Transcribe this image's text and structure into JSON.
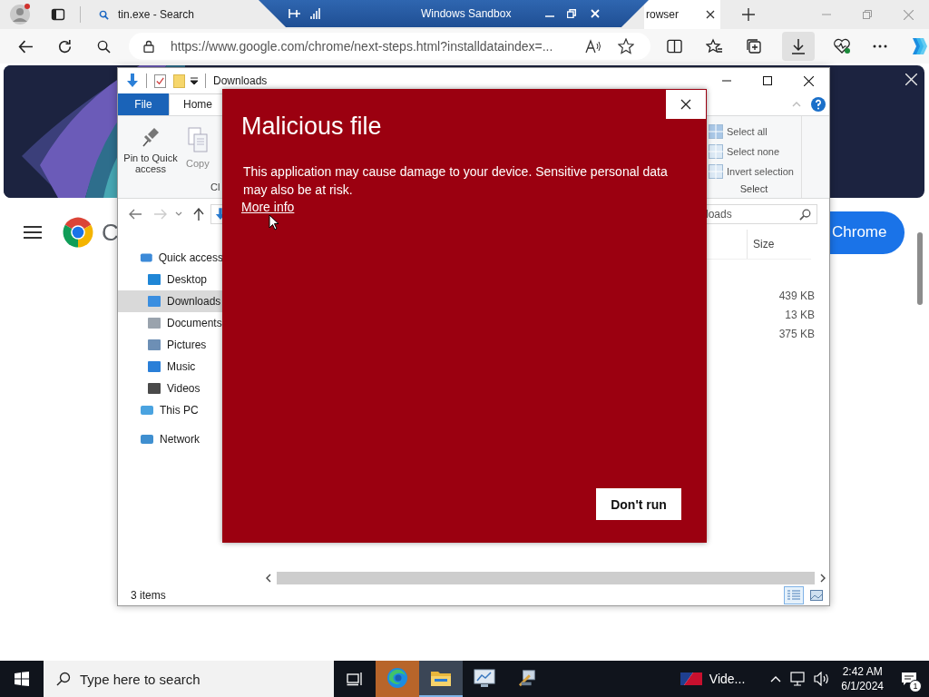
{
  "browser": {
    "tabs": [
      {
        "label": "tin.exe - Search",
        "selected": false
      },
      {
        "label": "rowser",
        "selected": true
      }
    ],
    "address": "https://www.google.com/chrome/next-steps.html?installdataindex=...",
    "page": {
      "brand_letter": "C",
      "button": "Chrome"
    }
  },
  "sandbox_bar": {
    "title": "Windows Sandbox"
  },
  "explorer": {
    "title": "Downloads",
    "ribbon_tabs": [
      {
        "label": "File",
        "kind": "file",
        "selected": false
      },
      {
        "label": "Home",
        "kind": "tab",
        "selected": true
      }
    ],
    "clipboard": {
      "buttons": [
        "Pin to Quick access",
        "Copy"
      ],
      "group_label": "Cl"
    },
    "select": {
      "commands": [
        "Select all",
        "Select none",
        "Invert selection"
      ],
      "group_label": "Select"
    },
    "search": {
      "value": "loads"
    },
    "column": "Size",
    "nav": [
      {
        "label": "Quick access",
        "selected": false,
        "children": [
          {
            "label": "Desktop",
            "selected": false
          },
          {
            "label": "Downloads",
            "selected": true
          },
          {
            "label": "Documents",
            "selected": false
          },
          {
            "label": "Pictures",
            "selected": false
          },
          {
            "label": "Music",
            "selected": false
          },
          {
            "label": "Videos",
            "selected": false
          }
        ]
      },
      {
        "label": "This PC",
        "selected": false
      },
      {
        "label": "Network",
        "selected": false
      }
    ],
    "files": [
      {
        "size": "439 KB"
      },
      {
        "size": "13 KB"
      },
      {
        "size": "375 KB"
      }
    ],
    "status": "3 items"
  },
  "dialog": {
    "title": "Malicious file",
    "message": "This application may cause damage to your device. Sensitive personal data may also be at risk.",
    "link": "More info",
    "button": "Don't run"
  },
  "taskbar": {
    "search_placeholder": "Type here to search",
    "apps": [
      {
        "flashing": true,
        "selected": false
      },
      {
        "flashing": false,
        "selected": true
      },
      {
        "flashing": false,
        "selected": false
      },
      {
        "flashing": false,
        "selected": false
      }
    ],
    "widget": "Vide...",
    "time": "2:42 AM",
    "date": "6/1/2024",
    "notifications": "1"
  }
}
